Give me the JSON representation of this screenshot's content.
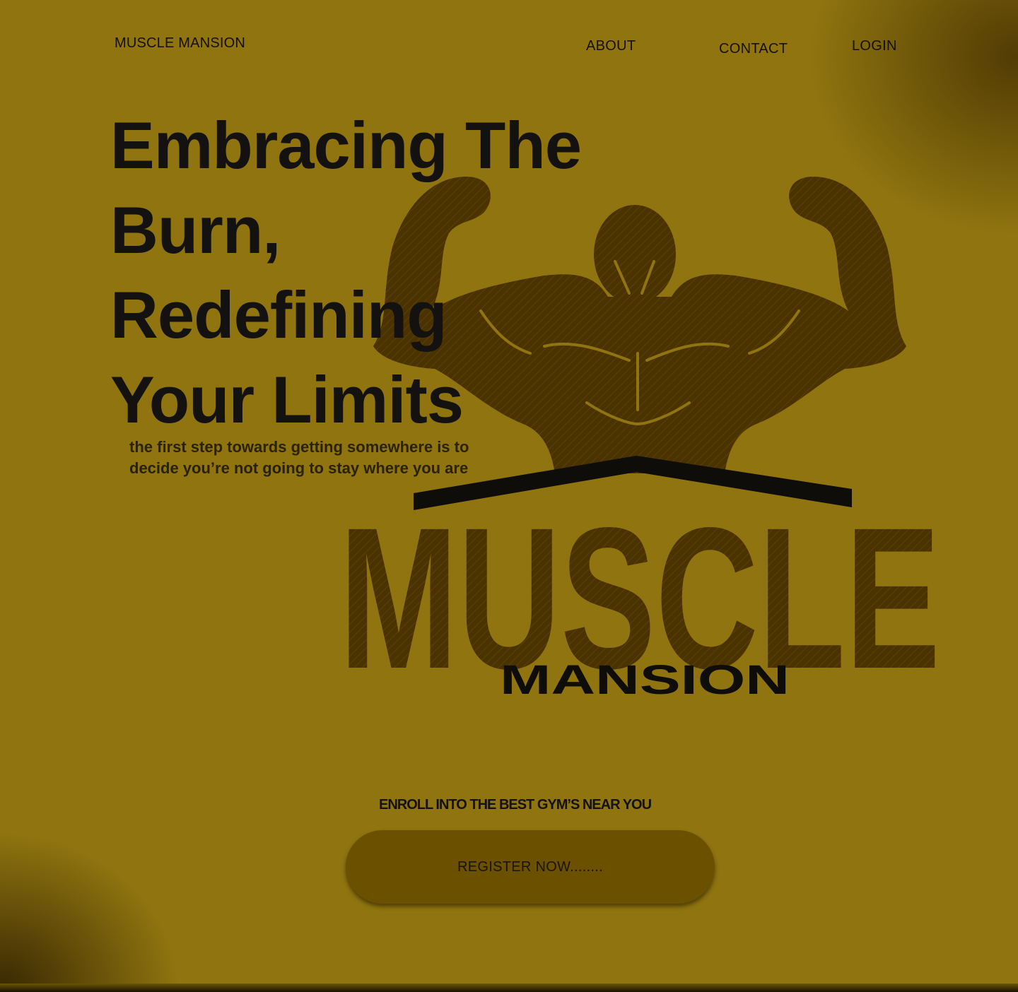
{
  "header": {
    "brand": "MUSCLE MANSION",
    "nav": {
      "about": "ABOUT",
      "contact": "CONTACT",
      "login": "LOGIN"
    }
  },
  "hero": {
    "title_lines": [
      "Embracing The",
      "Burn,",
      "Redefining",
      "Your Limits"
    ],
    "subtitle_lines": [
      "the first step towards getting somewhere is to",
      "decide you’re not going  to stay where you are"
    ]
  },
  "logo": {
    "word_main": "MUSCLE",
    "word_sub": "MANSION"
  },
  "cta": {
    "tagline": "ENROLL INTO THE BEST GYM’S NEAR YOU",
    "register_label": "REGISTER NOW........"
  },
  "colors": {
    "background": "#8f740f",
    "logo_dark": "#4a3300",
    "button": "#6b5000",
    "text": "#141210"
  }
}
